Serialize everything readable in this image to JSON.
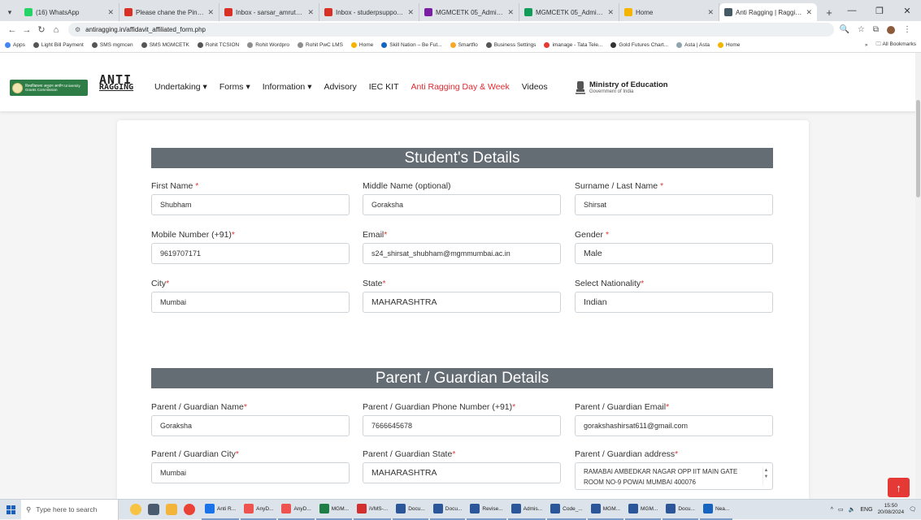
{
  "browser": {
    "tabs": [
      {
        "title": "(16) WhatsApp",
        "color": "#25d366"
      },
      {
        "title": "Please chane the Pincode",
        "color": "#d93025"
      },
      {
        "title": "Inbox - sarsar_amruta@m",
        "color": "#d93025"
      },
      {
        "title": "Inbox - studerpsupport@",
        "color": "#d93025"
      },
      {
        "title": "MGMCETK 05_Admission",
        "color": "#7b1fa2"
      },
      {
        "title": "MGMCETK 05_Admission",
        "color": "#0f9d58"
      },
      {
        "title": "Home",
        "color": "#f4b400"
      },
      {
        "title": "Anti Ragging | Ragging in",
        "color": "#455a64",
        "active": true
      }
    ],
    "url": "antiragging.in/affidavit_affiliated_form.php",
    "bookmarks": [
      {
        "label": "Apps",
        "color": "#4285f4"
      },
      {
        "label": "Light Bill Payment",
        "color": "#555"
      },
      {
        "label": "SMS mgmcen",
        "color": "#555"
      },
      {
        "label": "SMS MGMCETK",
        "color": "#555"
      },
      {
        "label": "Rohit TCSION",
        "color": "#555"
      },
      {
        "label": "Rohit Wordpro",
        "color": "#8e8e8e"
      },
      {
        "label": "Rohit PwC LMS",
        "color": "#8e8e8e"
      },
      {
        "label": "Home",
        "color": "#f4b400"
      },
      {
        "label": "Skill Nation – Be Fut...",
        "color": "#1565c0"
      },
      {
        "label": "Smartflo",
        "color": "#f9a825"
      },
      {
        "label": "Business Settings",
        "color": "#555"
      },
      {
        "label": "imanage - Tata Tele...",
        "color": "#e53935"
      },
      {
        "label": "Gold Futures Chart...",
        "color": "#333"
      },
      {
        "label": "Asta | Asta",
        "color": "#90a4ae"
      },
      {
        "label": "Home",
        "color": "#f4b400"
      }
    ],
    "bookmarks_more": "»",
    "all_bookmarks": "All Bookmarks"
  },
  "site": {
    "ugc_text": "विश्वविद्यालय अनुदान आयोग University Grants Commission",
    "anti": "ANTI",
    "ragging": "RAGGING",
    "nav": [
      {
        "label": "Undertaking ▾",
        "highlight": false
      },
      {
        "label": "Forms ▾",
        "highlight": false
      },
      {
        "label": "Information ▾",
        "highlight": false
      },
      {
        "label": "Advisory",
        "highlight": false
      },
      {
        "label": "IEC KIT",
        "highlight": false
      },
      {
        "label": "Anti Ragging Day & Week",
        "highlight": true
      },
      {
        "label": "Videos",
        "highlight": false
      }
    ],
    "ministry_title": "Ministry of Education",
    "ministry_sub": "Government of India"
  },
  "form": {
    "student_title": "Student's Details",
    "parent_title": "Parent / Guardian Details",
    "fields": {
      "first_name": {
        "label": "First Name ",
        "req": "*",
        "value": "Shubham"
      },
      "middle_name": {
        "label": "Middle Name (optional)",
        "req": "",
        "value": "Goraksha"
      },
      "surname": {
        "label": "Surname / Last Name ",
        "req": "*",
        "value": "Shirsat"
      },
      "mobile": {
        "label": "Mobile Number (+91)",
        "req": "*",
        "value": "9619707171"
      },
      "email": {
        "label": "Email",
        "req": "*",
        "value": "s24_shirsat_shubham@mgmmumbai.ac.in"
      },
      "gender": {
        "label": "Gender ",
        "req": "*",
        "value": "Male"
      },
      "city": {
        "label": "City",
        "req": "*",
        "value": "Mumbai"
      },
      "state": {
        "label": "State",
        "req": "*",
        "value": "MAHARASHTRA"
      },
      "nationality": {
        "label": "Select Nationality",
        "req": "*",
        "value": "Indian"
      },
      "parent_name": {
        "label": "Parent / Guardian Name",
        "req": "*",
        "value": "Goraksha"
      },
      "parent_phone": {
        "label": "Parent / Guardian Phone Number (+91)",
        "req": "*",
        "value": "7666645678"
      },
      "parent_email": {
        "label": "Parent / Guardian Email",
        "req": "*",
        "value": "gorakshashirsat611@gmail.com"
      },
      "parent_city": {
        "label": "Parent / Guardian City",
        "req": "*",
        "value": "Mumbai"
      },
      "parent_state": {
        "label": "Parent / Guardian State",
        "req": "*",
        "value": "MAHARASHTRA"
      },
      "parent_address": {
        "label": "Parent / Guardian address",
        "req": "*",
        "value": "RAMABAI AMBEDKAR NAGAR OPP IIT MAIN GATE ROOM NO-9 POWAI MUMBAI 400076"
      }
    }
  },
  "taskbar": {
    "search_placeholder": "Type here to search",
    "apps": [
      {
        "label": "Anti R...",
        "color": "#1a73e8"
      },
      {
        "label": "AnyD...",
        "color": "#ef5350"
      },
      {
        "label": "AnyD...",
        "color": "#ef5350"
      },
      {
        "label": "MGM...",
        "color": "#1e7e45"
      },
      {
        "label": "iVMS-...",
        "color": "#d32f2f"
      },
      {
        "label": "Docu...",
        "color": "#2b579a"
      },
      {
        "label": "Docu...",
        "color": "#2b579a"
      },
      {
        "label": "Revise...",
        "color": "#2b579a"
      },
      {
        "label": "Admis...",
        "color": "#2b579a"
      },
      {
        "label": "Code_...",
        "color": "#2b579a"
      },
      {
        "label": "MGM...",
        "color": "#2b579a"
      },
      {
        "label": "MGM...",
        "color": "#2b579a"
      },
      {
        "label": "Docu...",
        "color": "#2b579a"
      },
      {
        "label": "Nea...",
        "color": "#1565c0"
      }
    ],
    "lang": "ENG",
    "time": "15:50",
    "date": "20/08/2024"
  }
}
